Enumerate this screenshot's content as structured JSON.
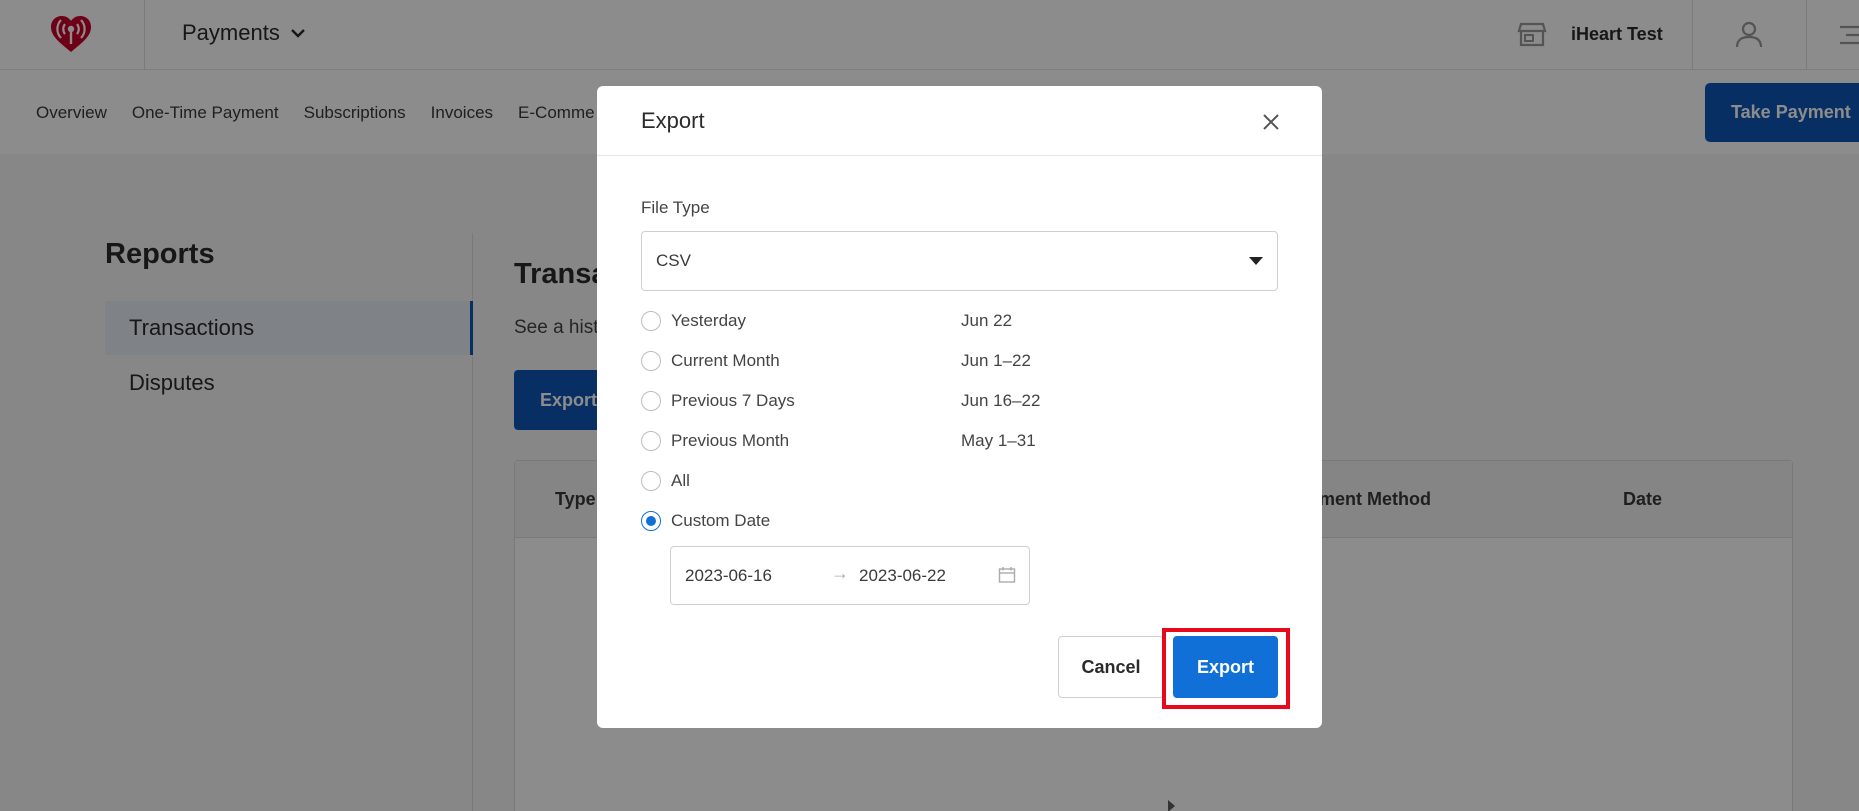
{
  "header": {
    "app_switcher_label": "Payments",
    "account_name": "iHeart Test",
    "brand_color": "#c6002b"
  },
  "subnav": {
    "items": [
      "Overview",
      "One-Time Payment",
      "Subscriptions",
      "Invoices",
      "E-Comme"
    ],
    "take_payment_label": "Take Payment"
  },
  "sidebar": {
    "title": "Reports",
    "items": [
      {
        "label": "Transactions",
        "active": true
      },
      {
        "label": "Disputes",
        "active": false
      }
    ]
  },
  "main": {
    "title": "Transa",
    "description": "See a hist",
    "export_label": "Export",
    "table_headers": [
      "Type",
      "yment Method",
      "Date"
    ]
  },
  "modal": {
    "title": "Export",
    "file_type_label": "File Type",
    "file_type_value": "CSV",
    "options": [
      {
        "label": "Yesterday",
        "range": "Jun 22",
        "checked": false
      },
      {
        "label": "Current Month",
        "range": "Jun 1–22",
        "checked": false
      },
      {
        "label": "Previous 7 Days",
        "range": "Jun 16–22",
        "checked": false
      },
      {
        "label": "Previous Month",
        "range": "May 1–31",
        "checked": false
      },
      {
        "label": "All",
        "range": "",
        "checked": false
      },
      {
        "label": "Custom Date",
        "range": "",
        "checked": true
      }
    ],
    "custom_start": "2023-06-16",
    "custom_end": "2023-06-22",
    "range_separator": "→",
    "cancel_label": "Cancel",
    "export_label": "Export"
  },
  "colors": {
    "primary_blue": "#0d57b7",
    "button_blue": "#1070d8",
    "highlight_red": "#e8091c"
  }
}
